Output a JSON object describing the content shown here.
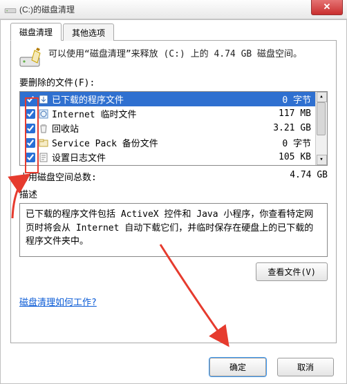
{
  "window": {
    "title": "(C:)的磁盘清理"
  },
  "tabs": {
    "cleanup": "磁盘清理",
    "other": "其他选项"
  },
  "intro": {
    "text": "可以使用“磁盘清理”来释放  (C:) 上的 4.74 GB 磁盘空间。"
  },
  "labels": {
    "files_to_delete": "要删除的文件(F):",
    "total_gain": "占用磁盘空间总数:",
    "description": "描述",
    "view_files": "查看文件(V)",
    "help_link": "磁盘清理如何工作?",
    "ok": "确定",
    "cancel": "取消"
  },
  "totals": {
    "total_value": "4.74 GB"
  },
  "list": {
    "items": [
      {
        "name": "已下载的程序文件",
        "size": "0 字节",
        "checked": true,
        "selected": true
      },
      {
        "name": "Internet 临时文件",
        "size": "117 MB",
        "checked": true,
        "selected": false
      },
      {
        "name": "回收站",
        "size": "3.21 GB",
        "checked": true,
        "selected": false
      },
      {
        "name": "Service Pack 备份文件",
        "size": "0 字节",
        "checked": true,
        "selected": false
      },
      {
        "name": "设置日志文件",
        "size": "105 KB",
        "checked": true,
        "selected": false
      }
    ]
  },
  "description": {
    "text": "已下载的程序文件包括 ActiveX 控件和 Java 小程序，你查看特定网页时将会从 Internet 自动下载它们，并临时保存在硬盘上的已下载的程序文件夹中。"
  }
}
